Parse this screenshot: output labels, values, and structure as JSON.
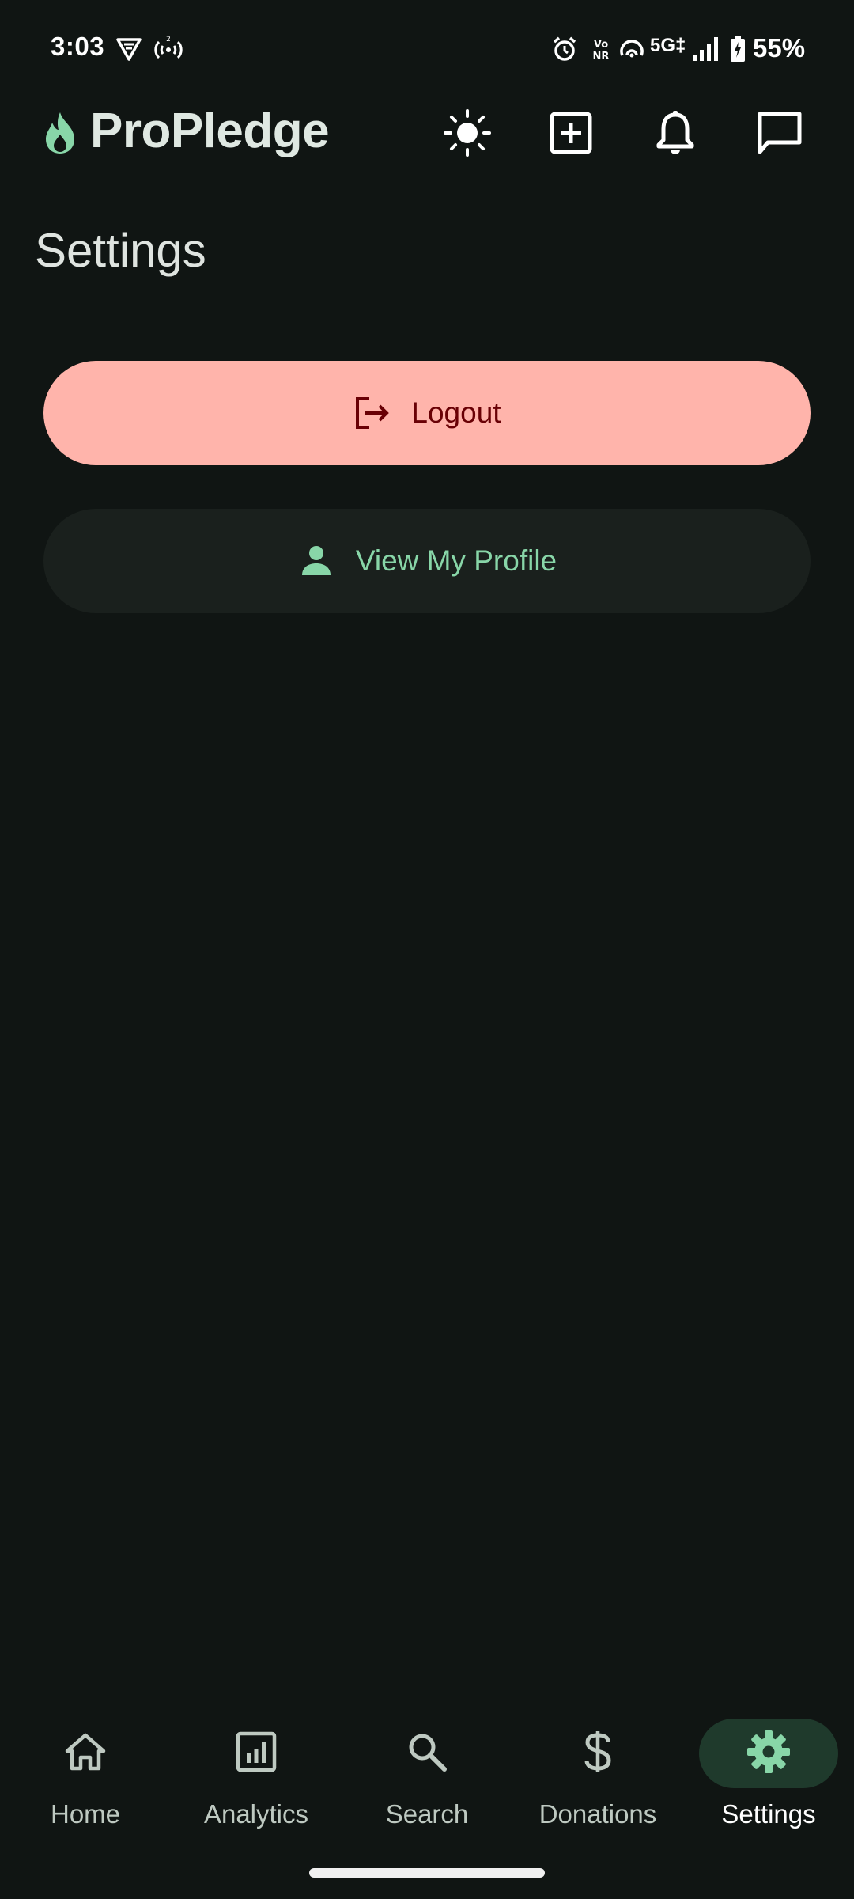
{
  "status_bar": {
    "time": "3:03",
    "network": "5G",
    "network_suffix": "‡",
    "battery": "55%",
    "icons": [
      "vpn-shield-icon",
      "hotspot-icon",
      "alarm-icon",
      "vonr-icon",
      "wifi-calling-icon",
      "signal-icon",
      "battery-icon"
    ]
  },
  "app": {
    "name": "ProPledge",
    "logo": "flame-icon",
    "accent": "#88d6a8",
    "actions": [
      "theme-toggle",
      "create",
      "notifications",
      "messages"
    ]
  },
  "page": {
    "title": "Settings"
  },
  "buttons": {
    "logout": {
      "label": "Logout",
      "icon": "logout-icon",
      "bg": "#ffb4ab",
      "fg": "#690005"
    },
    "profile": {
      "label": "View My Profile",
      "icon": "person-icon",
      "bg": "#1a201d",
      "fg": "#88d6a8"
    }
  },
  "bottom_nav": {
    "active": "Settings",
    "items": [
      {
        "label": "Home",
        "icon": "home-icon"
      },
      {
        "label": "Analytics",
        "icon": "analytics-icon"
      },
      {
        "label": "Search",
        "icon": "search-icon"
      },
      {
        "label": "Donations",
        "icon": "dollar-icon"
      },
      {
        "label": "Settings",
        "icon": "gear-icon"
      }
    ]
  }
}
